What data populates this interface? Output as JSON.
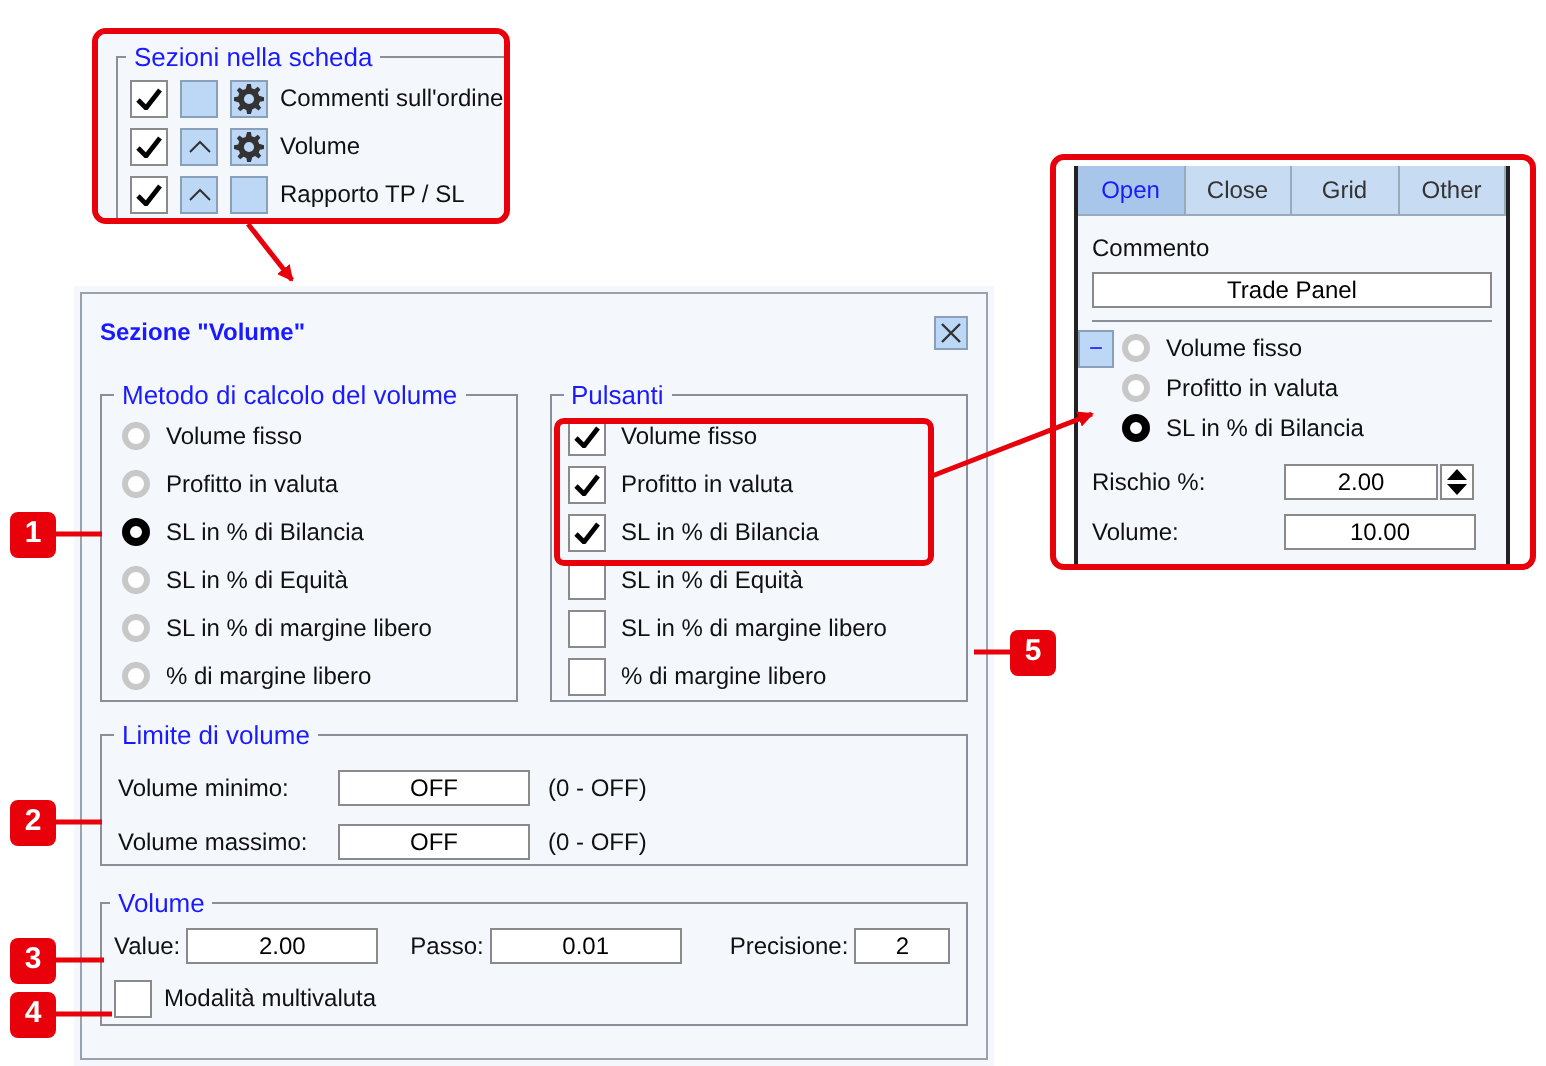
{
  "tab_sections": {
    "legend": "Sezioni nella scheda",
    "rows": [
      {
        "label": "Commenti sull'ordine",
        "checked": true,
        "up_arrow": false,
        "settings_icon": true
      },
      {
        "label": "Volume",
        "checked": true,
        "up_arrow": true,
        "settings_icon": true
      },
      {
        "label": "Rapporto TP / SL",
        "checked": true,
        "up_arrow": true,
        "settings_icon": false
      }
    ]
  },
  "dialog": {
    "title": "Sezione \"Volume\"",
    "method": {
      "legend": "Metodo di calcolo del volume",
      "options": [
        {
          "label": "Volume fisso",
          "selected": false
        },
        {
          "label": "Profitto in valuta",
          "selected": false
        },
        {
          "label": "SL in % di Bilancia",
          "selected": true
        },
        {
          "label": "SL in % di Equità",
          "selected": false
        },
        {
          "label": "SL in % di margine libero",
          "selected": false
        },
        {
          "label": "% di margine libero",
          "selected": false
        }
      ]
    },
    "buttons": {
      "legend": "Pulsanti",
      "options": [
        {
          "label": "Volume fisso",
          "checked": true
        },
        {
          "label": "Profitto in valuta",
          "checked": true
        },
        {
          "label": "SL in % di Bilancia",
          "checked": true
        },
        {
          "label": "SL in % di Equità",
          "checked": false
        },
        {
          "label": "SL in % di margine libero",
          "checked": false
        },
        {
          "label": "% di margine libero",
          "checked": false
        }
      ]
    },
    "limits": {
      "legend": "Limite di volume",
      "rows": [
        {
          "label": "Volume minimo:",
          "value": "OFF",
          "hint": "(0 - OFF)"
        },
        {
          "label": "Volume massimo:",
          "value": "OFF",
          "hint": "(0 - OFF)"
        }
      ]
    },
    "volume": {
      "legend": "Volume",
      "fields": [
        {
          "label": "Value:",
          "value": "2.00"
        },
        {
          "label": "Passo:",
          "value": "0.01"
        },
        {
          "label": "Precisione:",
          "value": "2"
        }
      ],
      "multicurrency": {
        "label": "Modalità multivaluta",
        "checked": false
      }
    }
  },
  "trade_panel": {
    "tabs": [
      {
        "label": "Open",
        "selected": true
      },
      {
        "label": "Close",
        "selected": false
      },
      {
        "label": "Grid",
        "selected": false
      },
      {
        "label": "Other",
        "selected": false
      }
    ],
    "comment_label": "Commento",
    "comment_value": "Trade Panel",
    "collapse_symbol": "−",
    "options": [
      {
        "label": "Volume fisso",
        "selected": false
      },
      {
        "label": "Profitto in valuta",
        "selected": false
      },
      {
        "label": "SL in % di Bilancia",
        "selected": true
      }
    ],
    "fields": [
      {
        "label": "Rischio %:",
        "value": "2.00",
        "kind": "spinner"
      },
      {
        "label": "Volume:",
        "value": "10.00",
        "kind": "text"
      }
    ]
  },
  "callouts": [
    {
      "number": "1"
    },
    {
      "number": "2"
    },
    {
      "number": "3"
    },
    {
      "number": "4"
    },
    {
      "number": "5"
    }
  ]
}
